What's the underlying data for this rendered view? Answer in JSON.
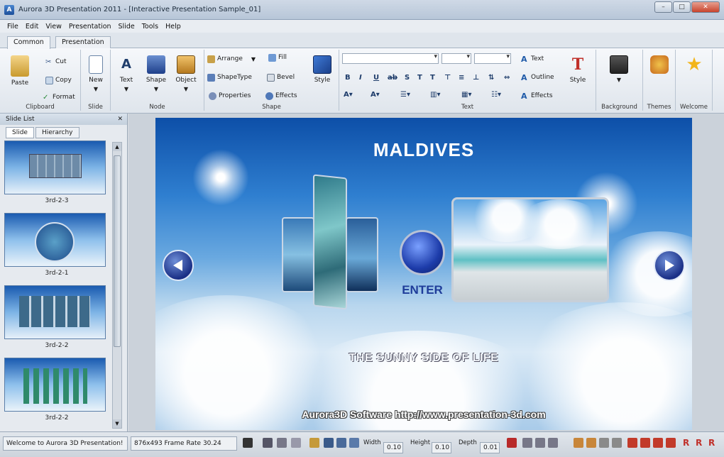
{
  "window": {
    "title": "Aurora 3D Presentation 2011 - [Interactive Presentation Sample_01]",
    "controls": [
      "–",
      "□",
      "✕"
    ]
  },
  "menu": [
    "File",
    "Edit",
    "View",
    "Presentation",
    "Slide",
    "Tools",
    "Help"
  ],
  "ribbon_tabs": [
    "Common",
    "Presentation"
  ],
  "ribbon": {
    "clipboard": {
      "paste": "Paste",
      "cut": "Cut",
      "copy": "Copy",
      "format": "Format",
      "label": "Clipboard"
    },
    "slide": {
      "new": "New",
      "label": "Slide"
    },
    "node": {
      "text": "Text",
      "shape": "Shape",
      "object": "Object",
      "label": "Node"
    },
    "shape": {
      "arrange": "Arrange",
      "fill": "Fill",
      "shapetype": "ShapeType",
      "bevel": "Bevel",
      "properties": "Properties",
      "effects": "Effects",
      "style": "Style",
      "label": "Shape"
    },
    "text": {
      "text": "Text",
      "outline": "Outline",
      "effects": "Effects",
      "style": "Style",
      "label": "Text"
    },
    "background": {
      "label": "Background"
    },
    "themes": {
      "label": "Themes"
    },
    "welcome": {
      "label": "Welcome"
    }
  },
  "slide_list": {
    "header": "Slide List",
    "tabs": [
      "Slide",
      "Hierarchy"
    ],
    "slides": [
      {
        "label": "3rd-2-3"
      },
      {
        "label": "3rd-2-1"
      },
      {
        "label": "3rd-2-2"
      },
      {
        "label": "3rd-2-2"
      }
    ]
  },
  "slide": {
    "title": "MALDIVES",
    "enter": "ENTER",
    "tagline": "THE SUNNY SIDE OF LIFE",
    "credit": "Aurora3D Software   http://www.presentation-3d.com"
  },
  "status": {
    "message": "Welcome to Aurora 3D Presentation!",
    "frame": "876x493 Frame Rate 30.24",
    "width_label": "Width",
    "width_value": "0.10",
    "height_label": "Height",
    "height_value": "0.10",
    "depth_label": "Depth",
    "depth_value": "0.01"
  },
  "colors": {
    "ribbon_accent": "#1f3d6b",
    "slide_title": "#ffffff",
    "enter_text": "#1f3d9a"
  }
}
